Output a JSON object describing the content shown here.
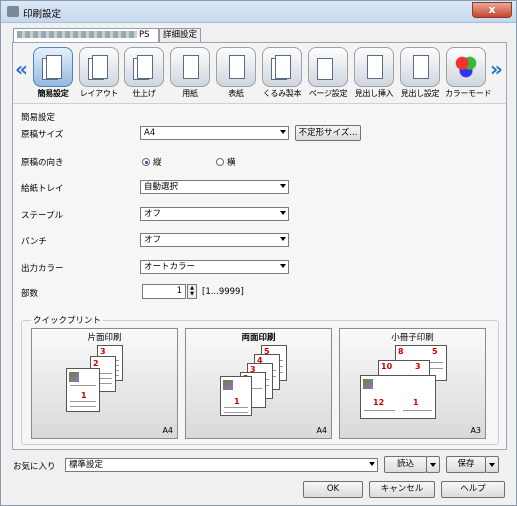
{
  "window": {
    "title": "印刷設定",
    "close_label": "x"
  },
  "tabs": [
    {
      "label": "PS"
    },
    {
      "label": "詳細設定"
    }
  ],
  "toolbar": {
    "left_arrow": "«",
    "right_arrow": "»",
    "items": [
      {
        "label": "簡易設定",
        "icon": "quick-settings-icon"
      },
      {
        "label": "レイアウト",
        "icon": "layout-icon"
      },
      {
        "label": "仕上げ",
        "icon": "finishing-icon"
      },
      {
        "label": "用紙",
        "icon": "paper-icon"
      },
      {
        "label": "表紙",
        "icon": "cover-icon"
      },
      {
        "label": "くるみ製本",
        "icon": "perfect-binding-icon"
      },
      {
        "label": "ページ設定",
        "icon": "page-settings-icon"
      },
      {
        "label": "見出し挿入",
        "icon": "tab-insert-icon"
      },
      {
        "label": "見出し設定",
        "icon": "tab-settings-icon"
      },
      {
        "label": "カラーモード",
        "icon": "color-mode-icon"
      }
    ]
  },
  "section": {
    "title": "簡易設定"
  },
  "form": {
    "original_size": {
      "label": "原稿サイズ",
      "value": "A4",
      "custom_button": "不定形サイズ..."
    },
    "orientation": {
      "label": "原稿の向き",
      "portrait": "縦",
      "landscape": "横"
    },
    "tray": {
      "label": "給紙トレイ",
      "value": "自動選択"
    },
    "staple": {
      "label": "ステープル",
      "value": "オフ"
    },
    "punch": {
      "label": "パンチ",
      "value": "オフ"
    },
    "output_color": {
      "label": "出力カラー",
      "value": "オートカラー"
    },
    "copies": {
      "label": "部数",
      "value": "1",
      "range": "[1...9999]"
    }
  },
  "quick_print": {
    "title": "クイックプリント",
    "presets": [
      {
        "title": "片面印刷",
        "size": "A4",
        "bold": false
      },
      {
        "title": "両面印刷",
        "size": "A4",
        "bold": true
      },
      {
        "title": "小冊子印刷",
        "size": "A3",
        "bold": false
      }
    ],
    "page_numbers": {
      "simplex": [
        "3",
        "2",
        "1"
      ],
      "duplex": [
        "5",
        "4",
        "3",
        "2",
        "1"
      ],
      "booklet": [
        "8",
        "5",
        "10",
        "3",
        "12",
        "1"
      ]
    }
  },
  "bottom": {
    "favorites_label": "お気に入り",
    "favorites_value": "標準設定",
    "load_button": "読込",
    "save_button": "保存",
    "ok_button": "OK",
    "cancel_button": "キャンセル",
    "help_button": "ヘルプ"
  }
}
